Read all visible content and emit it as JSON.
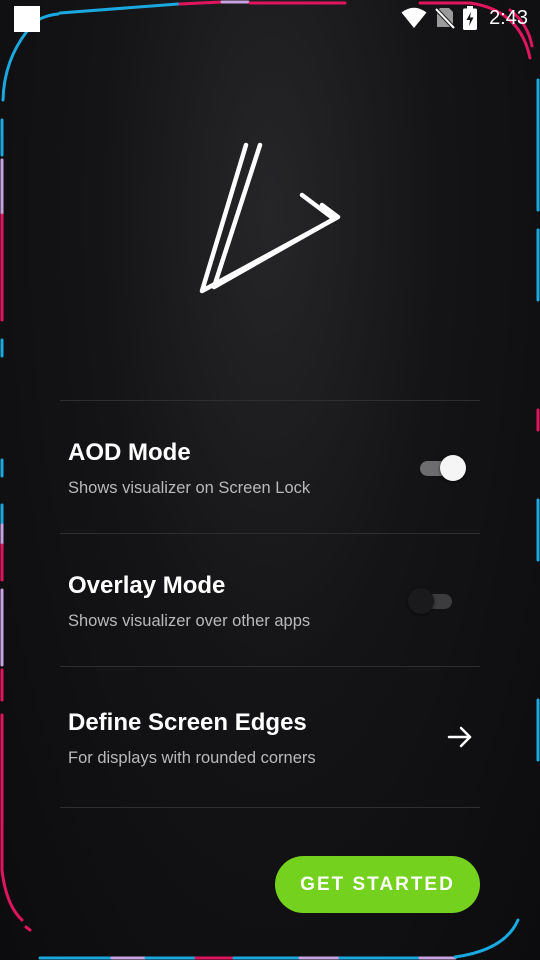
{
  "status_bar": {
    "time": "2:43",
    "icons": [
      "notification-square-icon",
      "wifi-icon",
      "no-sim-icon",
      "battery-charging-icon"
    ]
  },
  "logo": {
    "icon": "play-triangle-logo-icon"
  },
  "settings": {
    "items": [
      {
        "title": "AOD Mode",
        "subtitle": "Shows visualizer on Screen Lock",
        "control": "toggle",
        "enabled": true
      },
      {
        "title": "Overlay Mode",
        "subtitle": "Shows visualizer over other apps",
        "control": "toggle",
        "enabled": false
      },
      {
        "title": "Define Screen Edges",
        "subtitle": "For displays with rounded corners",
        "control": "arrow",
        "icon": "arrow-right-icon"
      }
    ]
  },
  "actions": {
    "get_started_label": "GET STARTED"
  },
  "colors": {
    "accent_green": "#74d11e",
    "edge_cyan": "#19a9e0",
    "edge_magenta": "#e0155e",
    "edge_lavender": "#c9a3e0",
    "background": "#141416"
  }
}
